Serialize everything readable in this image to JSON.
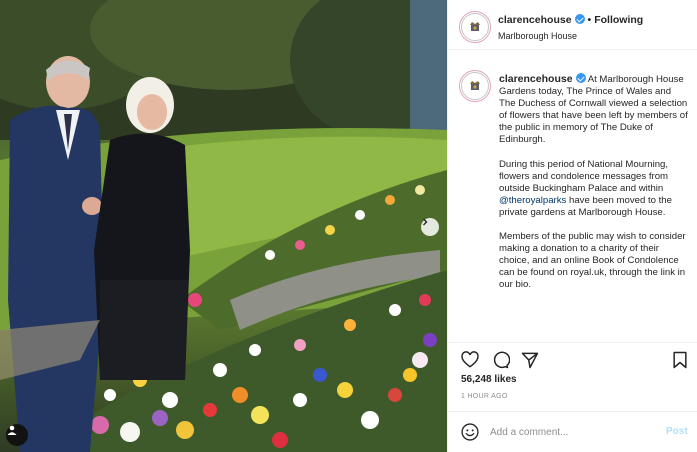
{
  "post": {
    "username": "clarencehouse",
    "follow_separator": "•",
    "follow_status": "Following",
    "location": "Marlborough House",
    "caption_paragraphs": [
      "At Marlborough House Gardens today, The Prince of Wales and The Duchess of Cornwall viewed a selection of flowers that have been left by members of the public in memory of The Duke of Edinburgh.",
      "During this period of National Mourning, flowers and condolence messages from outside Buckingham Palace and within ",
      "have been moved to the private gardens at Marlborough House.",
      "Members of the public may wish to consider making a donation to a charity of their choice, and an online Book of Condolence can be found on royal.uk, through the link in our bio."
    ],
    "mention": "@theroyalparks",
    "likes": "56,248 likes",
    "timestamp": "1 HOUR AGO"
  },
  "comment": {
    "placeholder": "Add a comment...",
    "post_label": "Post"
  },
  "icons": {
    "verified": "verified-badge-icon",
    "like": "heart-icon",
    "comment": "comment-bubble-icon",
    "share": "paper-plane-icon",
    "save": "bookmark-icon",
    "emoji": "smiley-icon",
    "next": "chevron-right-icon",
    "tag": "user-tag-icon"
  },
  "colors": {
    "verified": "#3897f0",
    "link": "#00376b",
    "post_disabled": "#b2dffc",
    "muted": "#8e8e8e"
  }
}
